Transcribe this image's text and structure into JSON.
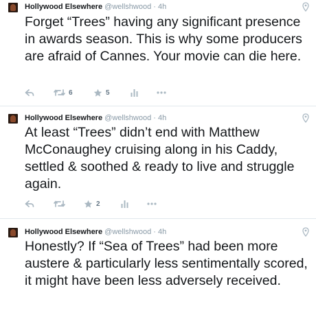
{
  "tweets": [
    {
      "name": "Hollywood Elsewhere",
      "handle": "@wellshwood",
      "time": "· 4h",
      "text": "Forget “Trees” having any significant presence in awards season. This is why some producers are afraid of Cannes.  Your movie can die here.",
      "retweets": "6",
      "favorites": "5"
    },
    {
      "name": "Hollywood Elsewhere",
      "handle": "@wellshwood",
      "time": "· 4h",
      "text": "At least “Trees” didn’t end with Matthew McConaughey cruising along in his Caddy, settled & soothed & ready to live and struggle again.",
      "retweets": "",
      "favorites": "2"
    },
    {
      "name": "Hollywood Elsewhere",
      "handle": "@wellshwood",
      "time": "· 4h",
      "text": "Honestly?  If “Sea of Trees” had been more austere & particularly less sentimentally scored, it might have been less adversely received.",
      "retweets": "",
      "favorites": ""
    }
  ],
  "colors": {
    "text": "#14171a",
    "muted": "#8899a6",
    "action": "#aab8c2",
    "divider": "#e1e8ed"
  },
  "icons": [
    "avatar",
    "geo-pin-icon",
    "reply-icon",
    "retweet-icon",
    "favorite-icon",
    "analytics-icon",
    "more-icon"
  ]
}
